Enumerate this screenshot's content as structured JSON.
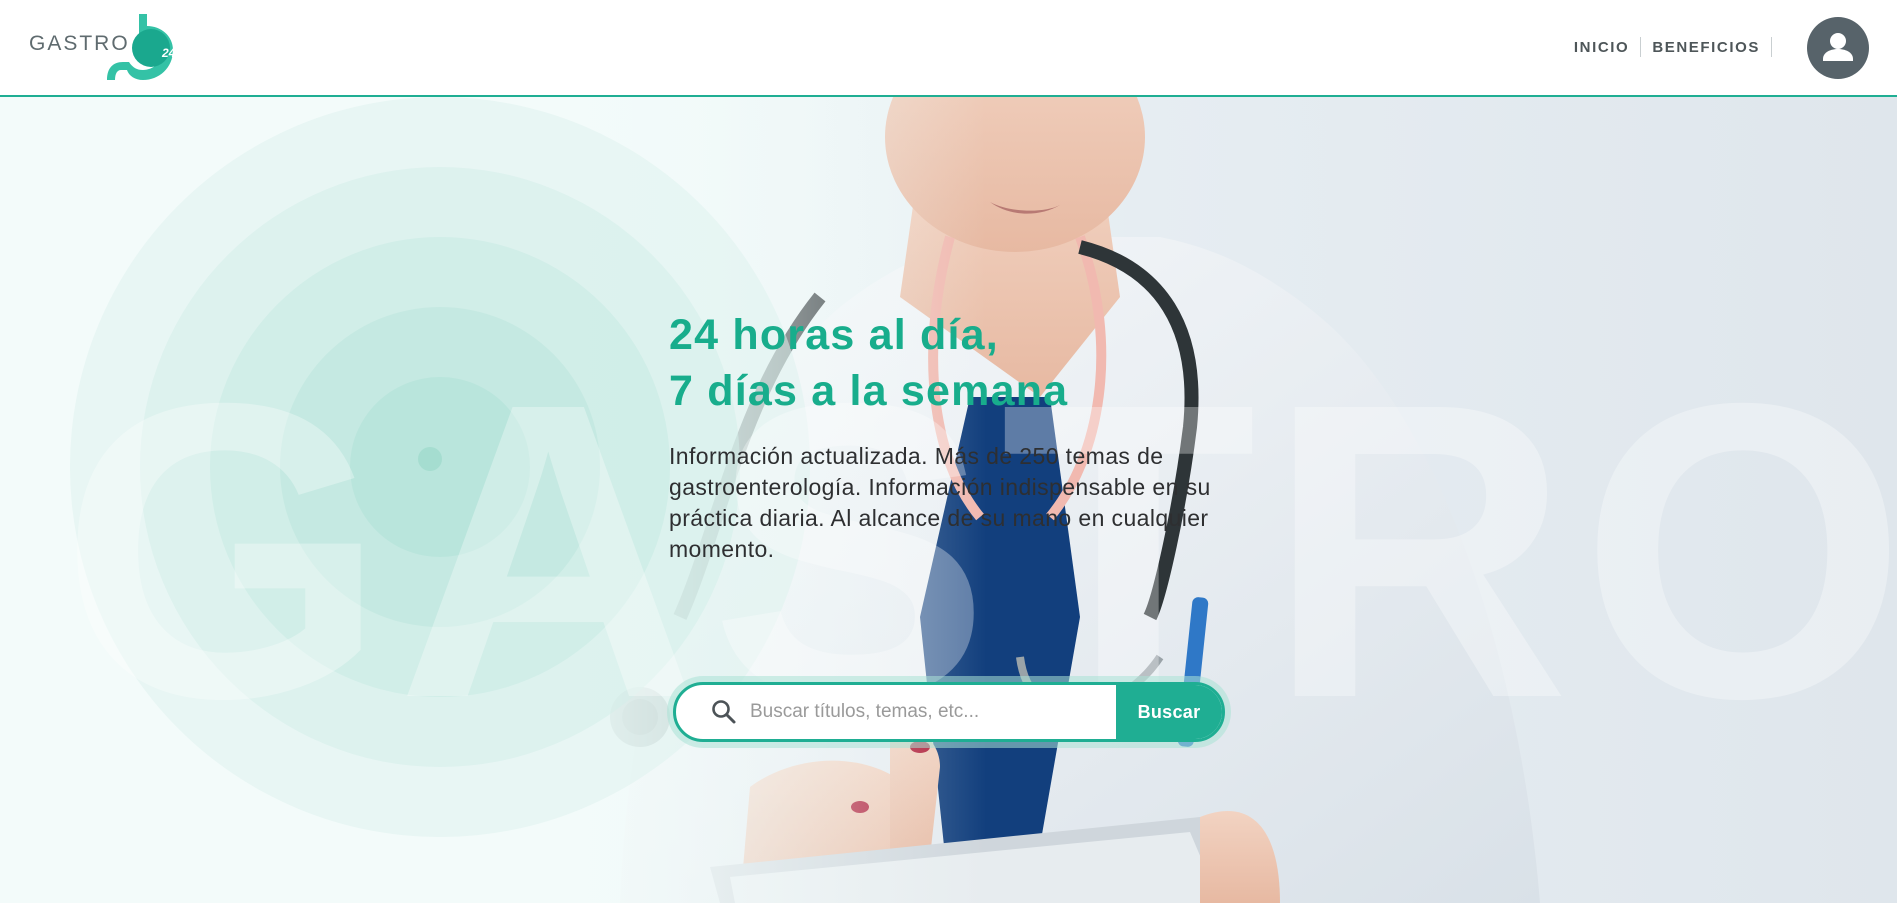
{
  "brand": {
    "logo_text": "GASTRO",
    "logo_badge": "24/7",
    "accent_color": "#1fae93"
  },
  "nav": {
    "items": [
      {
        "label": "INICIO"
      },
      {
        "label": "BENEFICIOS"
      }
    ],
    "account_icon": "user-account-icon"
  },
  "hero": {
    "headline_line1": "24 horas al día,",
    "headline_line2": "7 días a la semana",
    "description": "Información actualizada. Más de 250 temas de gastroenterología. Información indispensable en su práctica diaria. Al alcance de su mano en cualquier momento.",
    "background_word": "GASTRO",
    "search": {
      "icon": "search-icon",
      "placeholder": "Buscar títulos, temas, etc...",
      "value": "",
      "button_label": "Buscar"
    }
  }
}
